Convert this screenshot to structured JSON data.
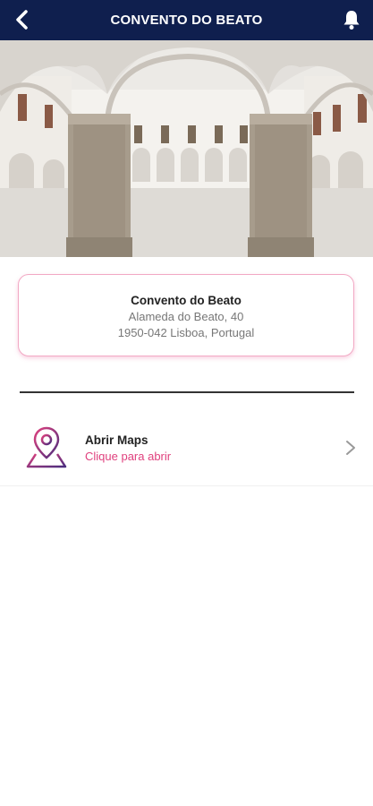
{
  "header": {
    "title": "CONVENTO DO BEATO",
    "back_icon": "chevron-left-icon",
    "notification_icon": "bell-icon",
    "background_color": "#0f1f4e"
  },
  "hero": {
    "image": "convent-cloister-arches-photo"
  },
  "location_card": {
    "name": "Convento do Beato",
    "address_line1": "Alameda do Beato, 40",
    "address_line2": "1950-042 Lisboa, Portugal",
    "border_color": "#f2a9c4"
  },
  "maps_action": {
    "title": "Abrir Maps",
    "subtitle": "Clique para abrir",
    "icon": "map-pin-icon",
    "accent_color": "#e0417e"
  }
}
